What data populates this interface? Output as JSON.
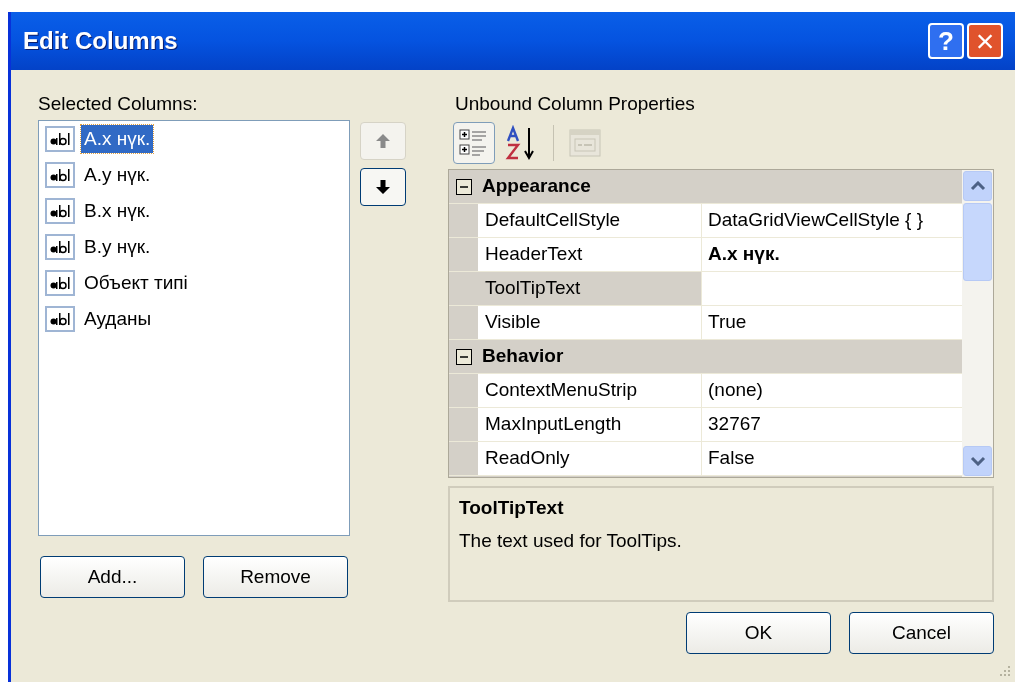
{
  "window": {
    "title": "Edit Columns",
    "help_button": "?",
    "close_button": "×"
  },
  "selected_columns": {
    "label": "Selected Columns:",
    "items": [
      {
        "text": "А.х нүк.",
        "selected": true
      },
      {
        "text": "А.у нүк.",
        "selected": false
      },
      {
        "text": "В.х нүк.",
        "selected": false
      },
      {
        "text": "В.у нүк.",
        "selected": false
      },
      {
        "text": "Объект типі",
        "selected": false
      },
      {
        "text": "Ауданы",
        "selected": false
      }
    ],
    "move_up": {
      "disabled": true
    },
    "move_down": {
      "disabled": false
    },
    "buttons": [
      "Add...",
      "Remove"
    ]
  },
  "properties": {
    "label": "Unbound Column Properties",
    "toolbar": [
      {
        "kind": "categorized",
        "selected": true,
        "disabled": false
      },
      {
        "kind": "alphabetical",
        "selected": false,
        "disabled": false
      },
      {
        "kind": "pages",
        "selected": false,
        "disabled": true
      }
    ],
    "groups": [
      {
        "name": "Appearance",
        "expanded": true,
        "rows": [
          {
            "name": "DefaultCellStyle",
            "value": "DataGridViewCellStyle { }",
            "bold": false,
            "selected": false
          },
          {
            "name": "HeaderText",
            "value": "А.х нүк.",
            "bold": true,
            "selected": false
          },
          {
            "name": "ToolTipText",
            "selected": true
          },
          {
            "name": "Visible",
            "value": "True",
            "bold": false,
            "selected": false
          }
        ]
      },
      {
        "name": "Behavior",
        "expanded": true,
        "rows": [
          {
            "name": "ContextMenuStrip",
            "value": "(none)",
            "bold": false,
            "selected": false
          },
          {
            "name": "MaxInputLength",
            "value": "32767",
            "bold": false,
            "selected": false
          },
          {
            "name": "ReadOnly",
            "value": "False",
            "bold": false,
            "selected": false
          }
        ]
      }
    ],
    "description": {
      "title": "ToolTipText",
      "text": "The text used for ToolTips."
    }
  },
  "dialog_buttons": [
    "OK",
    "Cancel"
  ]
}
